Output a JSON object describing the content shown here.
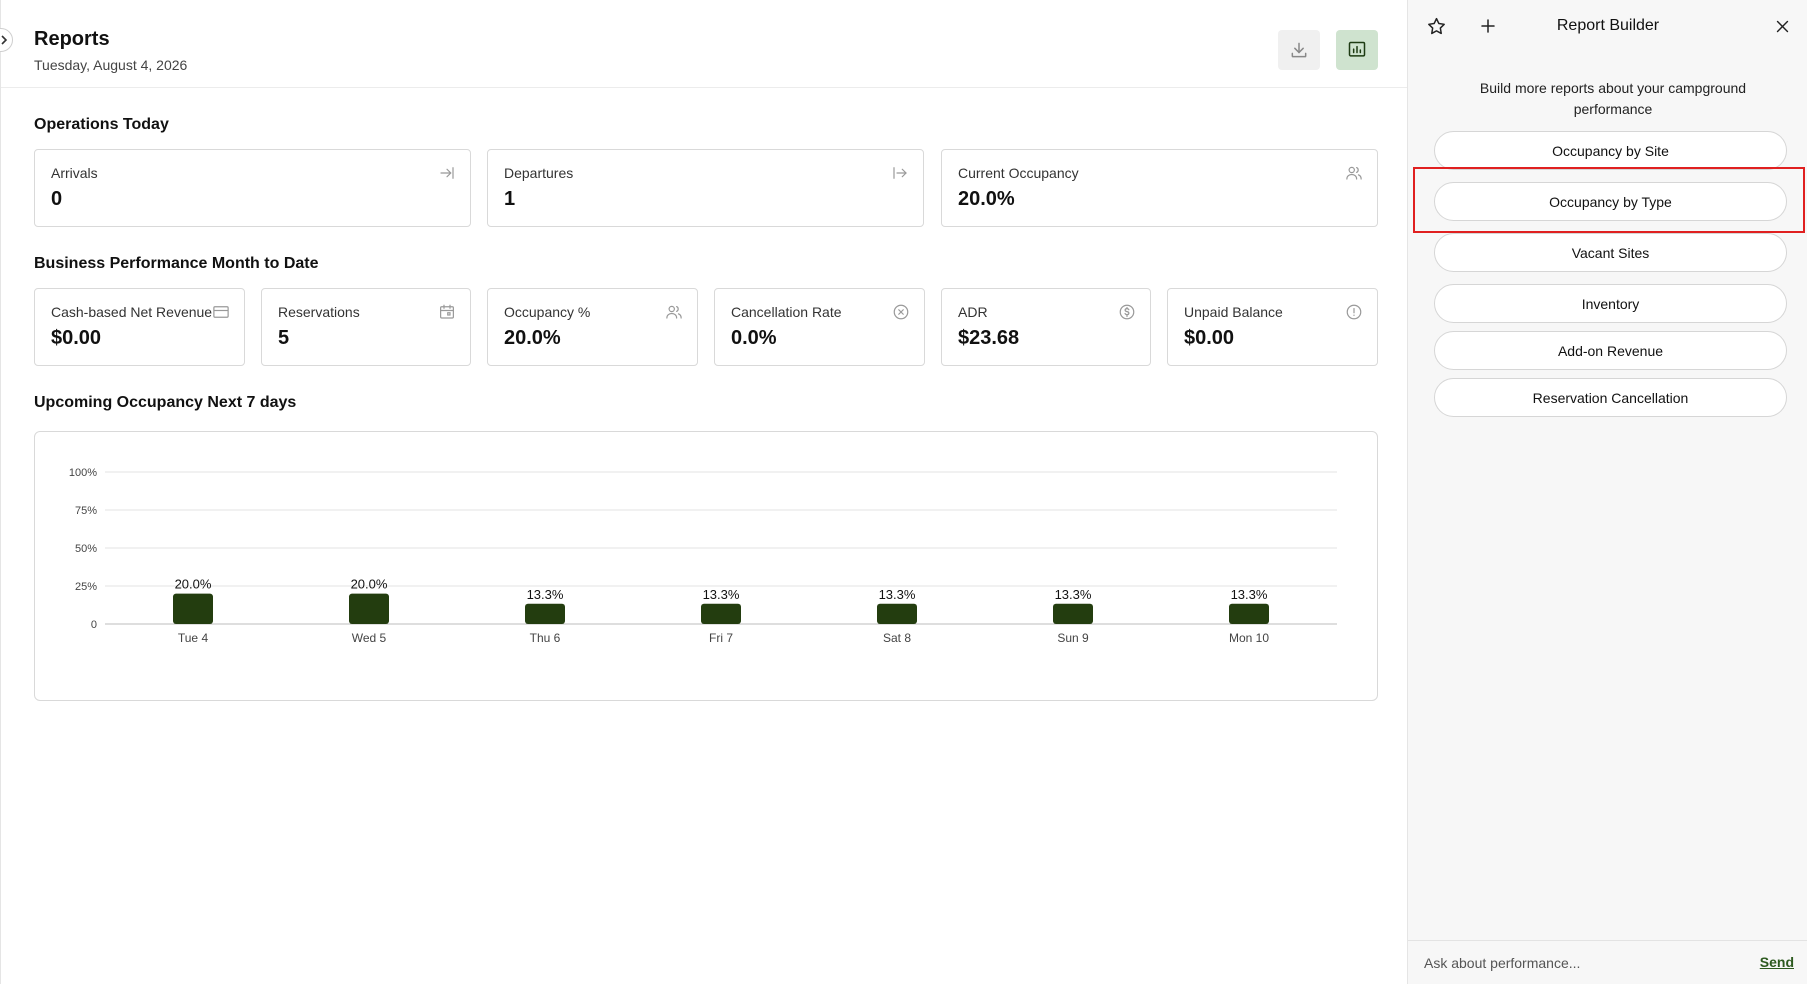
{
  "header": {
    "title": "Reports",
    "date": "Tuesday, August 4, 2026"
  },
  "operations": {
    "title": "Operations Today",
    "cards": [
      {
        "label": "Arrivals",
        "value": "0",
        "icon": "arrow-to-right-icon"
      },
      {
        "label": "Departures",
        "value": "1",
        "icon": "arrow-from-left-icon"
      },
      {
        "label": "Current Occupancy",
        "value": "20.0%",
        "icon": "users-icon"
      }
    ]
  },
  "business": {
    "title": "Business Performance Month to Date",
    "cards": [
      {
        "label": "Cash-based Net Revenue",
        "value": "$0.00",
        "icon": "credit-card-icon"
      },
      {
        "label": "Reservations",
        "value": "5",
        "icon": "calendar-icon"
      },
      {
        "label": "Occupancy %",
        "value": "20.0%",
        "icon": "users-icon"
      },
      {
        "label": "Cancellation Rate",
        "value": "0.0%",
        "icon": "x-circle-icon"
      },
      {
        "label": "ADR",
        "value": "$23.68",
        "icon": "dollar-circle-icon"
      },
      {
        "label": "Unpaid Balance",
        "value": "$0.00",
        "icon": "alert-circle-icon"
      }
    ]
  },
  "upcoming": {
    "title": "Upcoming Occupancy Next 7 days"
  },
  "chart_data": {
    "type": "bar",
    "categories": [
      "Tue 4",
      "Wed 5",
      "Thu 6",
      "Fri 7",
      "Sat 8",
      "Sun 9",
      "Mon 10"
    ],
    "values": [
      20.0,
      20.0,
      13.3,
      13.3,
      13.3,
      13.3,
      13.3
    ],
    "data_labels": [
      "20.0%",
      "20.0%",
      "13.3%",
      "13.3%",
      "13.3%",
      "13.3%",
      "13.3%"
    ],
    "yticks": [
      0,
      25,
      50,
      75,
      100
    ],
    "ytick_labels": [
      "0",
      "25%",
      "50%",
      "75%",
      "100%"
    ],
    "ylim": [
      0,
      100
    ],
    "grid": true,
    "bar_color": "#233d0f"
  },
  "panel": {
    "title": "Report Builder",
    "description": "Build more reports about your campground performance",
    "buttons": [
      "Occupancy by Site",
      "Occupancy by Type",
      "Vacant Sites",
      "Inventory",
      "Add-on Revenue",
      "Reservation Cancellation"
    ],
    "ask_placeholder": "Ask about performance...",
    "send_label": "Send"
  },
  "colors": {
    "accent": "#2d5a1f",
    "highlight": "#e02020"
  }
}
